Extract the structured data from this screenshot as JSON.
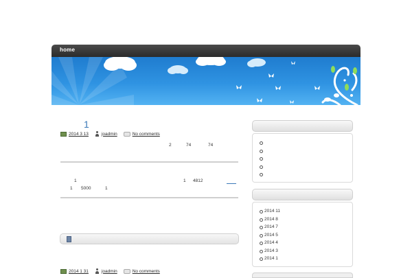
{
  "nav": {
    "home_label": "home"
  },
  "post1": {
    "title": "1",
    "date": "2014 3 13",
    "author": "joadmin",
    "comments": "No comments",
    "line1": [
      "2",
      "74",
      "74"
    ]
  },
  "post2": {
    "line_a": [
      "1",
      "1",
      "4812"
    ],
    "line_b": [
      "1",
      "5000",
      "1"
    ]
  },
  "post3": {
    "date": "2014 1 31",
    "author": "joadmin",
    "comments": "No comments"
  },
  "sidebar": {
    "box1_items": [
      "",
      "",
      "",
      "",
      ""
    ],
    "archives": [
      "2014 11",
      "2014 8",
      "2014 7",
      "2014 5",
      "2014 4",
      "2014 3",
      "2014 1"
    ]
  },
  "colors": {
    "nav_bg": "#333333",
    "banner_sky": "#2f93e2",
    "title_link": "#3a78b8"
  }
}
